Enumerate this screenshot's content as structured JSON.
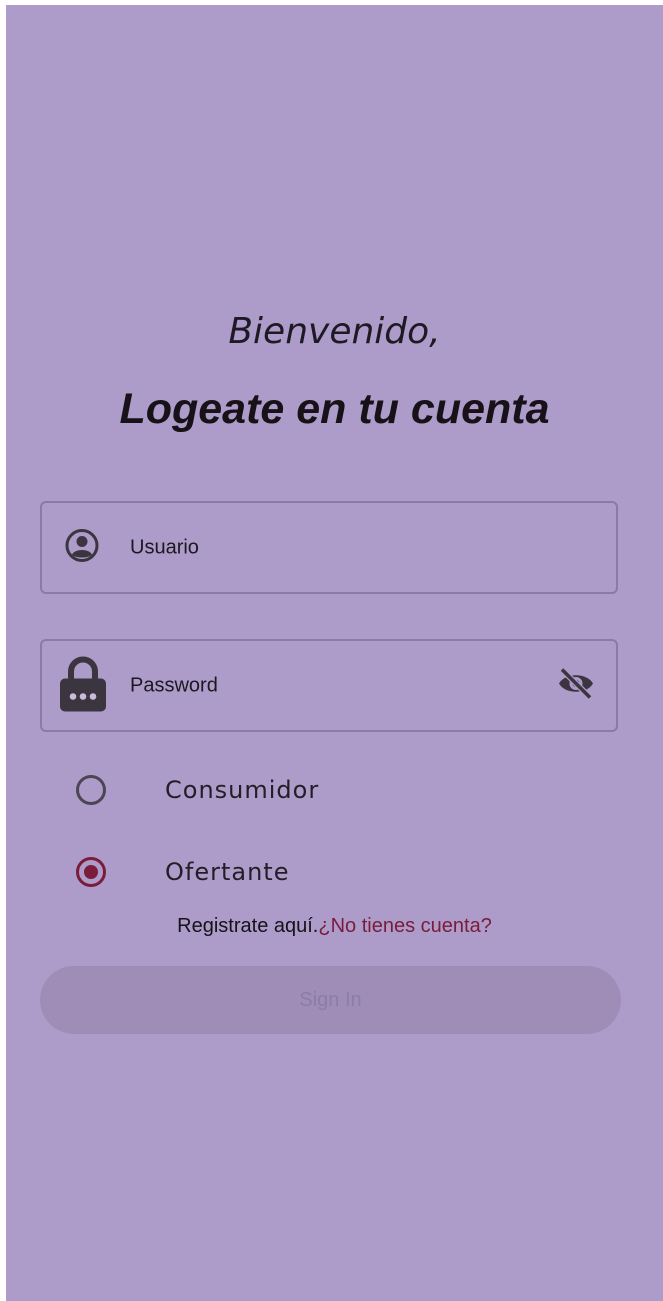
{
  "header": {
    "greeting": "Bienvenido,",
    "title": "Logeate en tu cuenta"
  },
  "form": {
    "username": {
      "label": "Usuario",
      "icon": "account-circle-icon"
    },
    "password": {
      "label": "Password",
      "icon": "lock-icon",
      "toggle_icon": "visibility-off-icon"
    },
    "roles": [
      {
        "label": "Consumidor",
        "selected": false
      },
      {
        "label": "Ofertante",
        "selected": true
      }
    ]
  },
  "register": {
    "text": "Registrate aquí.",
    "link": "¿No tienes cuenta?"
  },
  "signin_button": {
    "label": "Sign In",
    "enabled": false
  },
  "colors": {
    "background": "#ad9bc9",
    "accent": "#7a1c3a",
    "button_disabled": "#a08db7"
  }
}
